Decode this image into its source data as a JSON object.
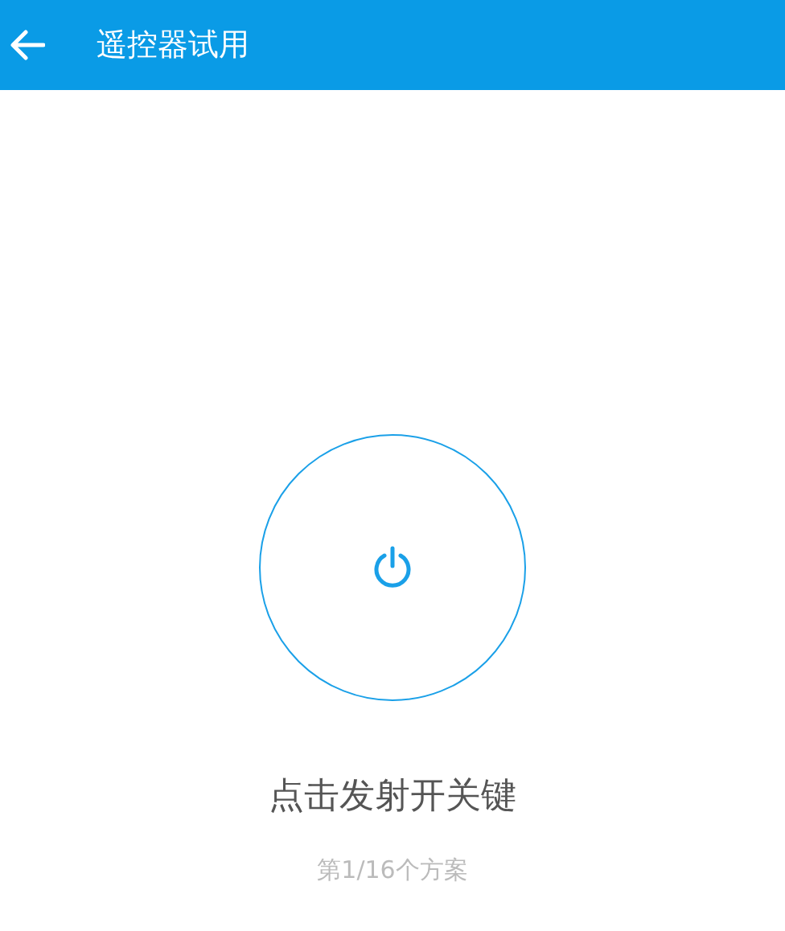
{
  "app_bar": {
    "title": "遥控器试用"
  },
  "prompt": "点击发射开关键",
  "scheme_counter": "第1/16个方案"
}
